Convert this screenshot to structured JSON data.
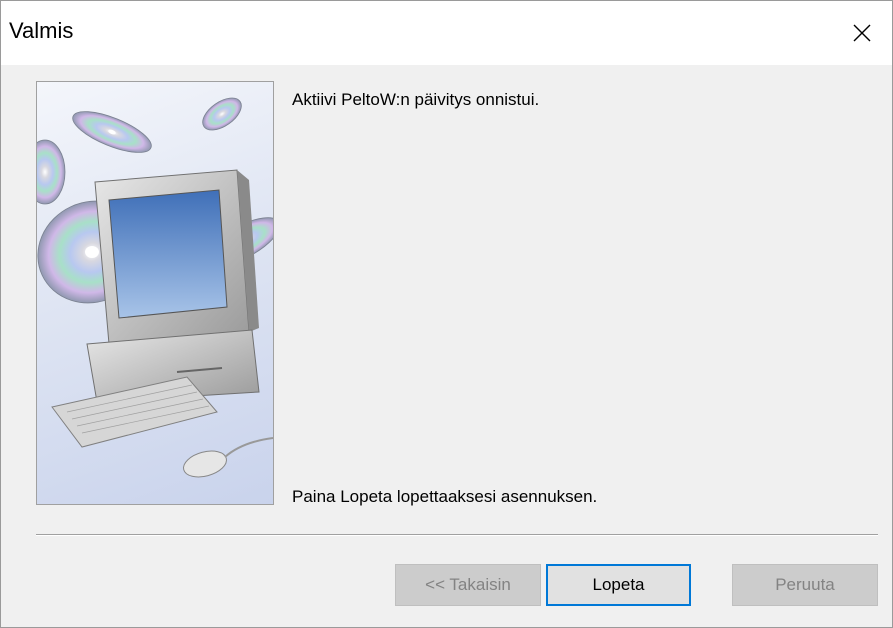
{
  "window": {
    "title": "Valmis",
    "close_icon": "close-icon"
  },
  "side_image": {
    "description_icon": "computer-with-cds-illustration"
  },
  "content": {
    "message_top": "Aktiivi PeltoW:n päivitys onnistui.",
    "message_bottom": "Paina Lopeta lopettaaksesi asennuksen."
  },
  "buttons": {
    "back_label": "<< Takaisin",
    "finish_label": "Lopeta",
    "cancel_label": "Peruuta",
    "back_enabled": false,
    "finish_enabled": true,
    "cancel_enabled": false
  },
  "colors": {
    "accent": "#0078d7",
    "dialog_bg": "#f0f0f0",
    "disabled_text": "#838383"
  }
}
